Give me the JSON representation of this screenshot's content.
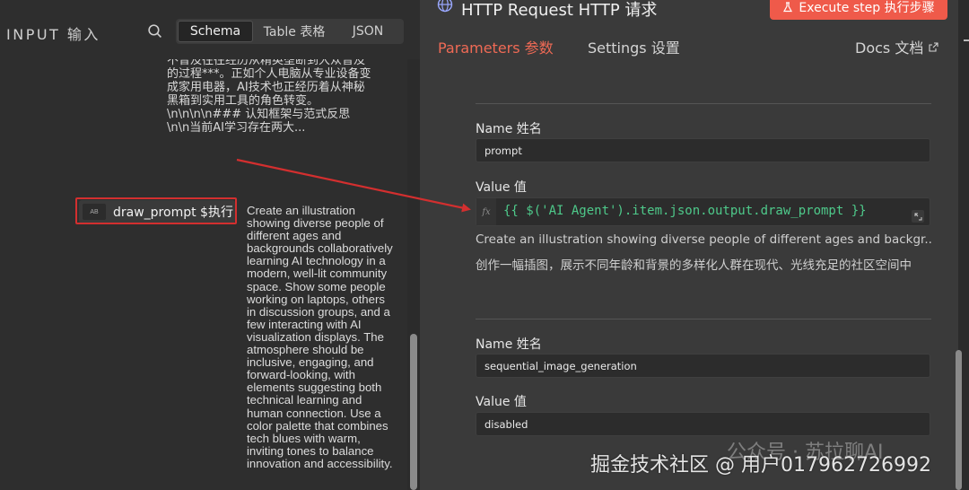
{
  "input_panel": {
    "title": "INPUT  输入",
    "tabs": [
      {
        "label": "Schema",
        "active": true
      },
      {
        "label": "Table 表格",
        "active": false
      },
      {
        "label": "JSON",
        "active": false
      }
    ],
    "prev_text_lines": [
      "不曾及往往经历从精英垄断到大众普及",
      "的过程***。正如个人电脑从专业设备变",
      "成家用电器，AI技术也正经历着从神秘",
      "黑箱到实用工具的角色转变。",
      "\\n\\n\\n\\n### 认知框架与范式反思",
      "\\n\\n当前AI学习存在两大..."
    ],
    "field": {
      "type_badge": "AB",
      "name": "draw_prompt  $执行",
      "value": "Create an illustration showing diverse people of different ages and backgrounds collaboratively learning AI technology in a modern, well-lit community space. Show some people working on laptops, others in discussion groups, and a few interacting with AI visualization displays. The atmosphere should be inclusive, engaging, and forward-looking, with elements suggesting both technical learning and human connection. Use a color palette that combines tech blues with warm, inviting tones to balance innovation and accessibility."
    }
  },
  "node_panel": {
    "title": "HTTP Request  HTTP 请求",
    "execute_label": "Execute step  执行步骤",
    "tabs": {
      "parameters": "Parameters  参数",
      "settings": "Settings  设置"
    },
    "docs_label": "Docs  文档",
    "params": [
      {
        "name_label": "Name  姓名",
        "name_value": "prompt",
        "value_label": "Value  值",
        "expression": "{{ $('AI Agent').item.json.output.draw_prompt }}",
        "preview_en": "Create an illustration showing diverse people of different ages and backgr...",
        "preview_zh": "创作一幅插图，展示不同年龄和背景的多样化人群在现代、光线充足的社区空间中"
      },
      {
        "name_label": "Name  姓名",
        "name_value": "sequential_image_generation",
        "value_label": "Value  值",
        "value": "disabled"
      }
    ]
  },
  "annotation": {
    "color": "#d32f2f"
  },
  "colors": {
    "accent": "#ef5a4a",
    "expression": "#4ec98a",
    "tab_active": "#ef6a55"
  },
  "watermark": {
    "primary": "掘金技术社区 @ 用户01796272699​2",
    "secondary": "公众号 · 苏拉聊AI"
  }
}
